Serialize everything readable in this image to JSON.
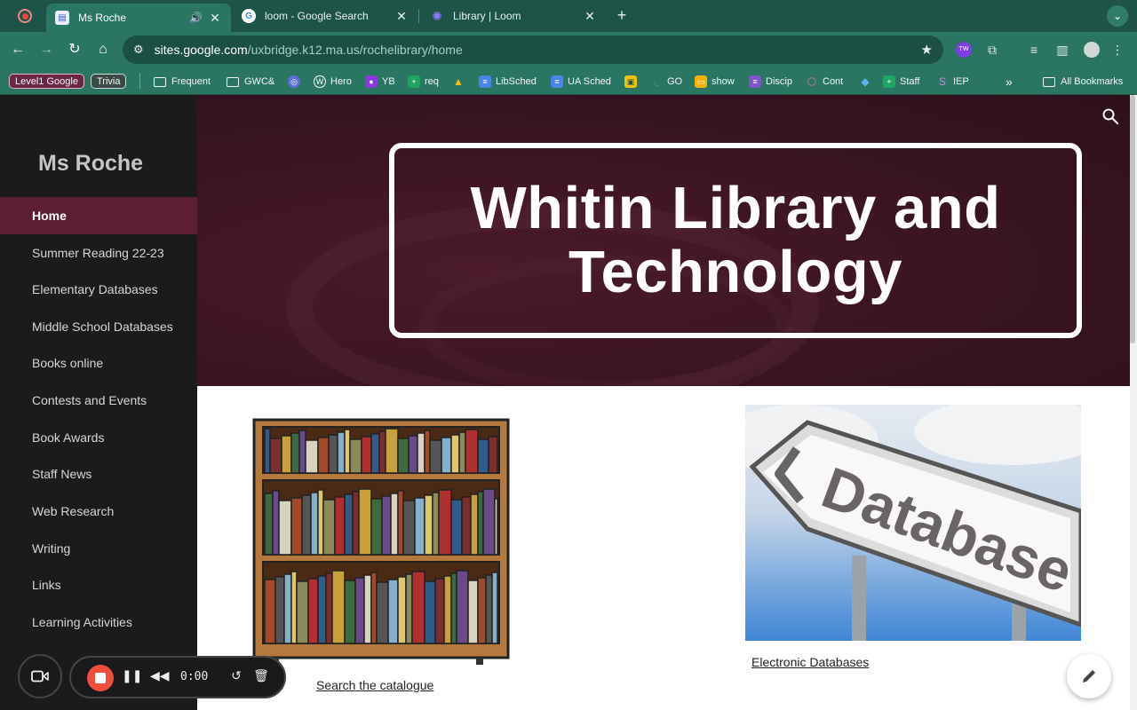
{
  "tabs": [
    {
      "title": "Ms Roche",
      "active": true
    },
    {
      "title": "loom - Google Search",
      "active": false
    },
    {
      "title": "Library | Loom",
      "active": false
    }
  ],
  "address": {
    "host": "sites.google.com",
    "path": "/uxbridge.k12.ma.us/rochelibrary/home"
  },
  "bookmarks": {
    "level1": "Level1 Google",
    "trivia": "Trivia",
    "frequent": "Frequent",
    "gwc": "GWC&",
    "hero": "Hero",
    "yb": "YB",
    "req": "req",
    "libsched": "LibSched",
    "uasched": "UA Sched",
    "go": "GO",
    "show": "show",
    "discip": "Discip",
    "cont": "Cont",
    "staff": "Staff",
    "iep": "IEP",
    "more": "»",
    "all": "All Bookmarks"
  },
  "site": {
    "title": "Ms Roche",
    "nav": [
      "Home",
      "Summer Reading 22-23",
      "Elementary Databases",
      "Middle School Databases",
      "Books online",
      "Contests and Events",
      "Book Awards",
      "Staff News",
      "Web Research",
      "Writing",
      "Links",
      "Learning Activities"
    ],
    "hero_line1": "Whitin Library and",
    "hero_line2": "Technology",
    "catalogue_link": "Search the catalogue",
    "databases_link": "Electronic Databases",
    "database_sign_text": "Database"
  },
  "loom": {
    "time": "0:00"
  },
  "colors": {
    "chrome": "#2a7663",
    "sidebar": "#1b1b1b",
    "nav_active": "#5b1e35",
    "hero": "#3a1422",
    "record": "#f04d3d"
  }
}
